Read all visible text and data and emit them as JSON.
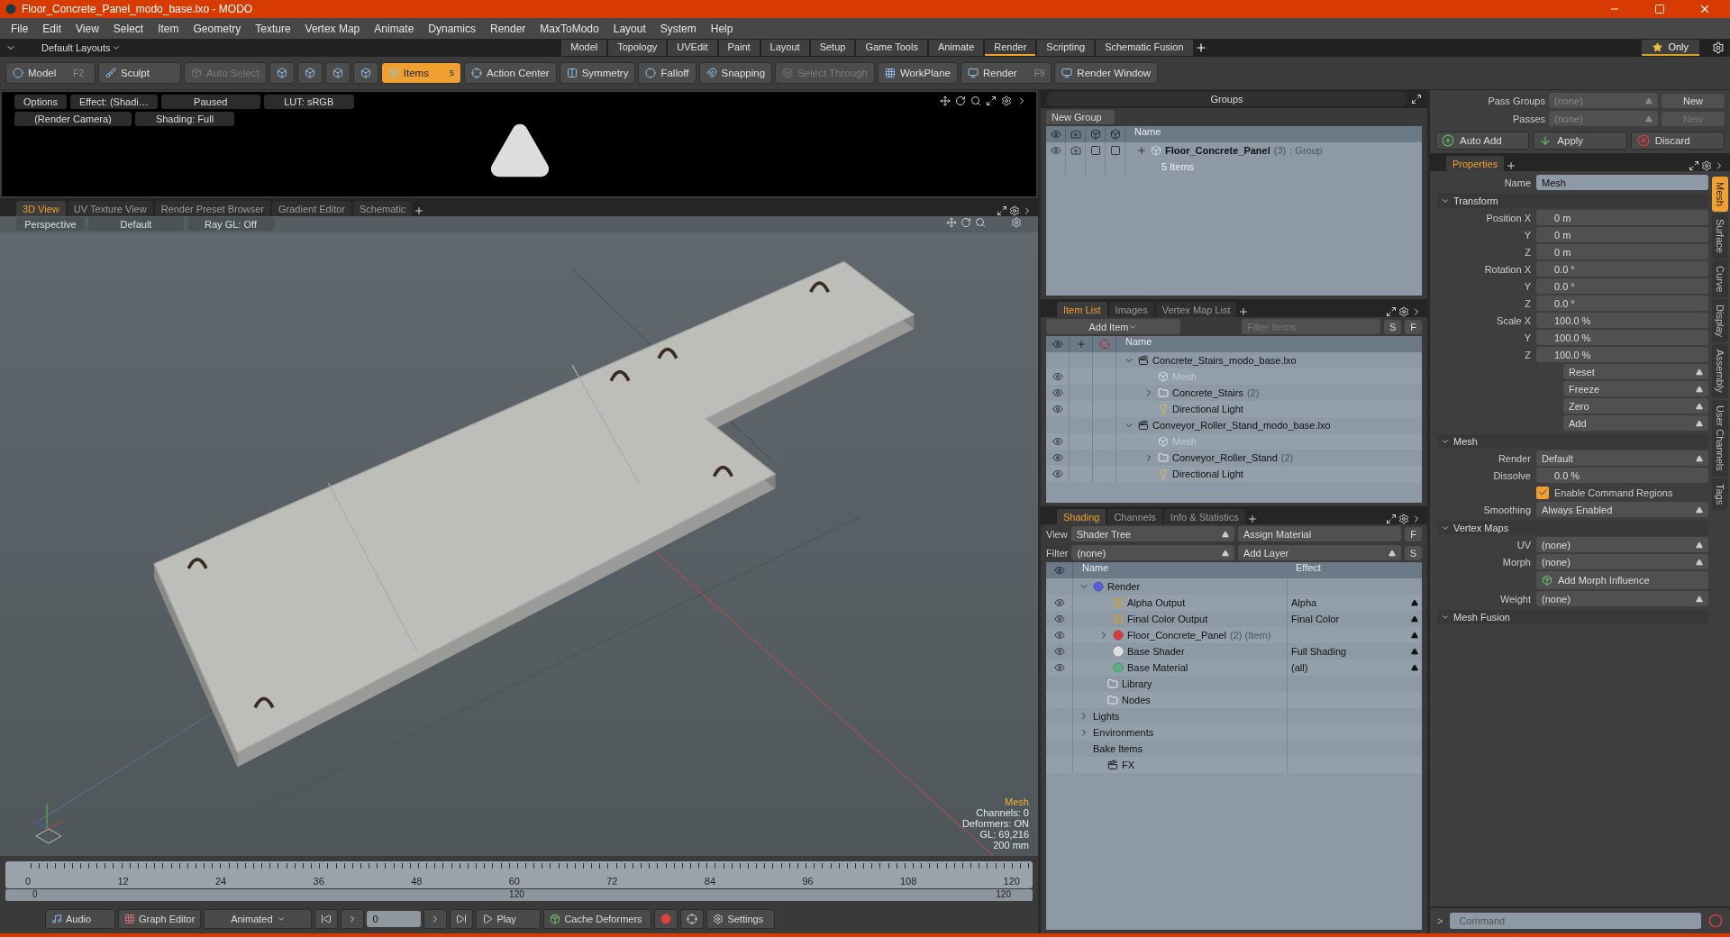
{
  "window": {
    "title": "Floor_Concrete_Panel_modo_base.lxo - MODO"
  },
  "menu": [
    "File",
    "Edit",
    "View",
    "Select",
    "Item",
    "Geometry",
    "Texture",
    "Vertex Map",
    "Animate",
    "Dynamics",
    "Render",
    "MaxToModo",
    "Layout",
    "System",
    "Help"
  ],
  "layouts": {
    "label": "Default Layouts",
    "only": "Only",
    "tabs": [
      {
        "label": "Model",
        "selected": false
      },
      {
        "label": "Topology",
        "selected": false
      },
      {
        "label": "UVEdit",
        "selected": false
      },
      {
        "label": "Paint",
        "selected": false
      },
      {
        "label": "Layout",
        "selected": false
      },
      {
        "label": "Setup",
        "selected": false
      },
      {
        "label": "Game Tools",
        "selected": false
      },
      {
        "label": "Animate",
        "selected": false
      },
      {
        "label": "Render",
        "selected": true
      },
      {
        "label": "Scripting",
        "selected": false
      },
      {
        "label": "Schematic Fusion",
        "selected": false
      }
    ]
  },
  "toolbar": [
    {
      "kind": "text",
      "label": "Model",
      "shortcut": "F2",
      "selected": false,
      "disabled": false
    },
    {
      "kind": "text",
      "label": "Sculpt",
      "selected": false,
      "disabled": false
    },
    {
      "kind": "text",
      "label": "Auto Select",
      "selected": false,
      "disabled": true
    },
    {
      "kind": "icon",
      "selected": false,
      "disabled": false
    },
    {
      "kind": "icon",
      "selected": false,
      "disabled": false
    },
    {
      "kind": "icon",
      "selected": false,
      "disabled": false
    },
    {
      "kind": "icon",
      "selected": false,
      "disabled": false
    },
    {
      "kind": "text",
      "label": "Items",
      "badge": "5",
      "selected": true,
      "disabled": false
    },
    {
      "kind": "text",
      "label": "Action Center",
      "selected": false,
      "disabled": false
    },
    {
      "kind": "text",
      "label": "Symmetry",
      "selected": false,
      "disabled": false
    },
    {
      "kind": "text",
      "label": "Falloff",
      "selected": false,
      "disabled": false
    },
    {
      "kind": "text",
      "label": "Snapping",
      "selected": false,
      "disabled": false
    },
    {
      "kind": "text",
      "label": "Select Through",
      "selected": false,
      "disabled": true
    },
    {
      "kind": "text",
      "label": "WorkPlane",
      "selected": false,
      "disabled": false
    },
    {
      "kind": "text",
      "label": "Render",
      "shortcut": "F9",
      "selected": false,
      "disabled": false
    },
    {
      "kind": "text",
      "label": "Render Window",
      "selected": false,
      "disabled": false
    }
  ],
  "preview": {
    "buttons": [
      "Options",
      "Effect: (Shadi…",
      "Paused",
      "LUT: sRGB",
      "(Render Camera)",
      "Shading: Full"
    ]
  },
  "viewport_tabs": [
    {
      "label": "3D View",
      "selected": true
    },
    {
      "label": "UV Texture View",
      "selected": false
    },
    {
      "label": "Render Preset Browser",
      "selected": false
    },
    {
      "label": "Gradient Editor",
      "selected": false
    },
    {
      "label": "Schematic",
      "selected": false
    }
  ],
  "viewport": {
    "buttons": [
      "Perspective",
      "Default",
      "Ray GL: Off"
    ],
    "info_title": "Mesh",
    "info_lines": [
      "Channels: 0",
      "Deformers: ON",
      "GL: 69,216",
      "200 mm"
    ]
  },
  "timeline": {
    "ticks": [
      "0",
      "12",
      "24",
      "36",
      "48",
      "60",
      "72",
      "84",
      "96",
      "108",
      "120"
    ],
    "range_start": "0",
    "range_mid": "120",
    "range_end": "120"
  },
  "transport": {
    "audio": "Audio",
    "graph_editor": "Graph Editor",
    "mode": "Animated",
    "frame": "0",
    "play": "Play",
    "cache": "Cache Deformers",
    "settings": "Settings"
  },
  "groups": {
    "title": "Groups",
    "new_group": "New Group",
    "column": "Name",
    "rows": [
      {
        "name": "Floor_Concrete_Panel",
        "count": "(3)",
        "type": ": Group",
        "detail": "5 Items"
      }
    ]
  },
  "item_list": {
    "tabs": [
      {
        "label": "Item List",
        "selected": true
      },
      {
        "label": "Images",
        "selected": false
      },
      {
        "label": "Vertex Map List",
        "selected": false
      }
    ],
    "add_item": "Add Item",
    "filter_placeholder": "Filter Items",
    "s": "S",
    "f": "F",
    "column": "Name",
    "tree": [
      {
        "name": "Concrete_Stairs_modo_base.lxo",
        "kind": "scene",
        "expanded": true,
        "visible": false,
        "children": [
          {
            "name": "Mesh",
            "kind": "mesh",
            "dim": true,
            "visible": true
          },
          {
            "name": "Concrete_Stairs",
            "count": "(2)",
            "kind": "group",
            "expanded": false,
            "visible": true
          },
          {
            "name": "Directional Light",
            "kind": "light",
            "visible": true
          }
        ]
      },
      {
        "name": "Conveyor_Roller_Stand_modo_base.lxo",
        "kind": "scene",
        "expanded": true,
        "visible": false,
        "children": [
          {
            "name": "Mesh",
            "kind": "mesh",
            "dim": true,
            "visible": true
          },
          {
            "name": "Conveyor_Roller_Stand",
            "count": "(2)",
            "kind": "group",
            "expanded": false,
            "visible": true
          },
          {
            "name": "Directional Light",
            "kind": "light",
            "visible": true
          }
        ]
      }
    ]
  },
  "shading": {
    "tabs": [
      {
        "label": "Shading",
        "selected": true
      },
      {
        "label": "Channels",
        "selected": false
      },
      {
        "label": "Info & Statistics",
        "selected": false
      }
    ],
    "view_label": "View",
    "view": "Shader Tree",
    "assign": "Assign Material",
    "f": "F",
    "filter_label": "Filter",
    "filter": "(none)",
    "add_layer": "Add Layer",
    "s": "S",
    "columns": [
      "Name",
      "Effect"
    ],
    "tree": [
      {
        "name": "Render",
        "kind": "render",
        "expanded": true,
        "visible": false,
        "children": [
          {
            "name": "Alpha Output",
            "kind": "output",
            "effect": "Alpha",
            "visible": true
          },
          {
            "name": "Final Color Output",
            "kind": "output",
            "effect": "Final Color",
            "visible": true
          },
          {
            "name": "Floor_Concrete_Panel",
            "count": "(2) (Item)",
            "kind": "material_group",
            "expanded": false,
            "visible": true
          },
          {
            "name": "Base Shader",
            "kind": "shader",
            "effect": "Full Shading",
            "visible": true
          },
          {
            "name": "Base Material",
            "kind": "material",
            "effect": "(all)",
            "visible": true
          }
        ]
      },
      {
        "name": "Library",
        "kind": "folder",
        "visible": false
      },
      {
        "name": "Nodes",
        "kind": "folder",
        "visible": false
      },
      {
        "name": "Lights",
        "expanded": false,
        "visible": false
      },
      {
        "name": "Environments",
        "expanded": false,
        "visible": false
      },
      {
        "name": "Bake Items",
        "visible": false
      },
      {
        "name": "FX",
        "kind": "fx",
        "visible": false
      }
    ]
  },
  "passes": {
    "pass_groups_label": "Pass Groups",
    "pass_groups": "(none)",
    "pass_groups_new": "New",
    "passes_label": "Passes",
    "passes": "(none)",
    "passes_new": "New",
    "disabled": true
  },
  "actions": [
    "Auto Add",
    "Apply",
    "Discard"
  ],
  "properties": {
    "tab": "Properties",
    "name_label": "Name",
    "name": "Mesh",
    "side_tabs": [
      {
        "label": "Mesh",
        "selected": true
      },
      {
        "label": "Surface",
        "selected": false
      },
      {
        "label": "Curve",
        "selected": false
      },
      {
        "label": "Display",
        "selected": false
      },
      {
        "label": "Assembly",
        "selected": false
      },
      {
        "label": "User Channels",
        "selected": false
      },
      {
        "label": "Tags",
        "selected": false
      }
    ],
    "sections": [
      {
        "title": "Transform",
        "expanded": true,
        "rows": [
          {
            "kind": "field",
            "label": "Position X",
            "value": "0 m"
          },
          {
            "kind": "field",
            "label": "Y",
            "value": "0 m"
          },
          {
            "kind": "field",
            "label": "Z",
            "value": "0 m"
          },
          {
            "kind": "field",
            "label": "Rotation X",
            "value": "0.0 °"
          },
          {
            "kind": "field",
            "label": "Y",
            "value": "0.0 °"
          },
          {
            "kind": "field",
            "label": "Z",
            "value": "0.0 °"
          },
          {
            "kind": "field",
            "label": "Scale X",
            "value": "100.0 %"
          },
          {
            "kind": "field",
            "label": "Y",
            "value": "100.0 %"
          },
          {
            "kind": "field",
            "label": "Z",
            "value": "100.0 %"
          },
          {
            "kind": "menu",
            "value": "Reset"
          },
          {
            "kind": "menu",
            "value": "Freeze"
          },
          {
            "kind": "menu",
            "value": "Zero"
          },
          {
            "kind": "menu",
            "value": "Add"
          }
        ]
      },
      {
        "title": "Mesh",
        "expanded": true,
        "rows": [
          {
            "kind": "dropdown",
            "label": "Render",
            "value": "Default"
          },
          {
            "kind": "field",
            "label": "Dissolve",
            "value": "0.0 %"
          },
          {
            "kind": "checkbox",
            "label": "Enable Command Regions",
            "checked": true
          },
          {
            "kind": "dropdown",
            "label": "Smoothing",
            "value": "Always Enabled"
          }
        ]
      },
      {
        "title": "Vertex Maps",
        "expanded": true,
        "rows": [
          {
            "kind": "dropdown",
            "label": "UV",
            "value": "(none)"
          },
          {
            "kind": "dropdown",
            "label": "Morph",
            "value": "(none)"
          },
          {
            "kind": "button",
            "label": "Add Morph Influence"
          },
          {
            "kind": "dropdown",
            "label": "Weight",
            "value": "(none)"
          }
        ]
      },
      {
        "title": "Mesh Fusion",
        "expanded": true
      }
    ]
  },
  "command": {
    "prompt": ">",
    "placeholder": "Command"
  }
}
